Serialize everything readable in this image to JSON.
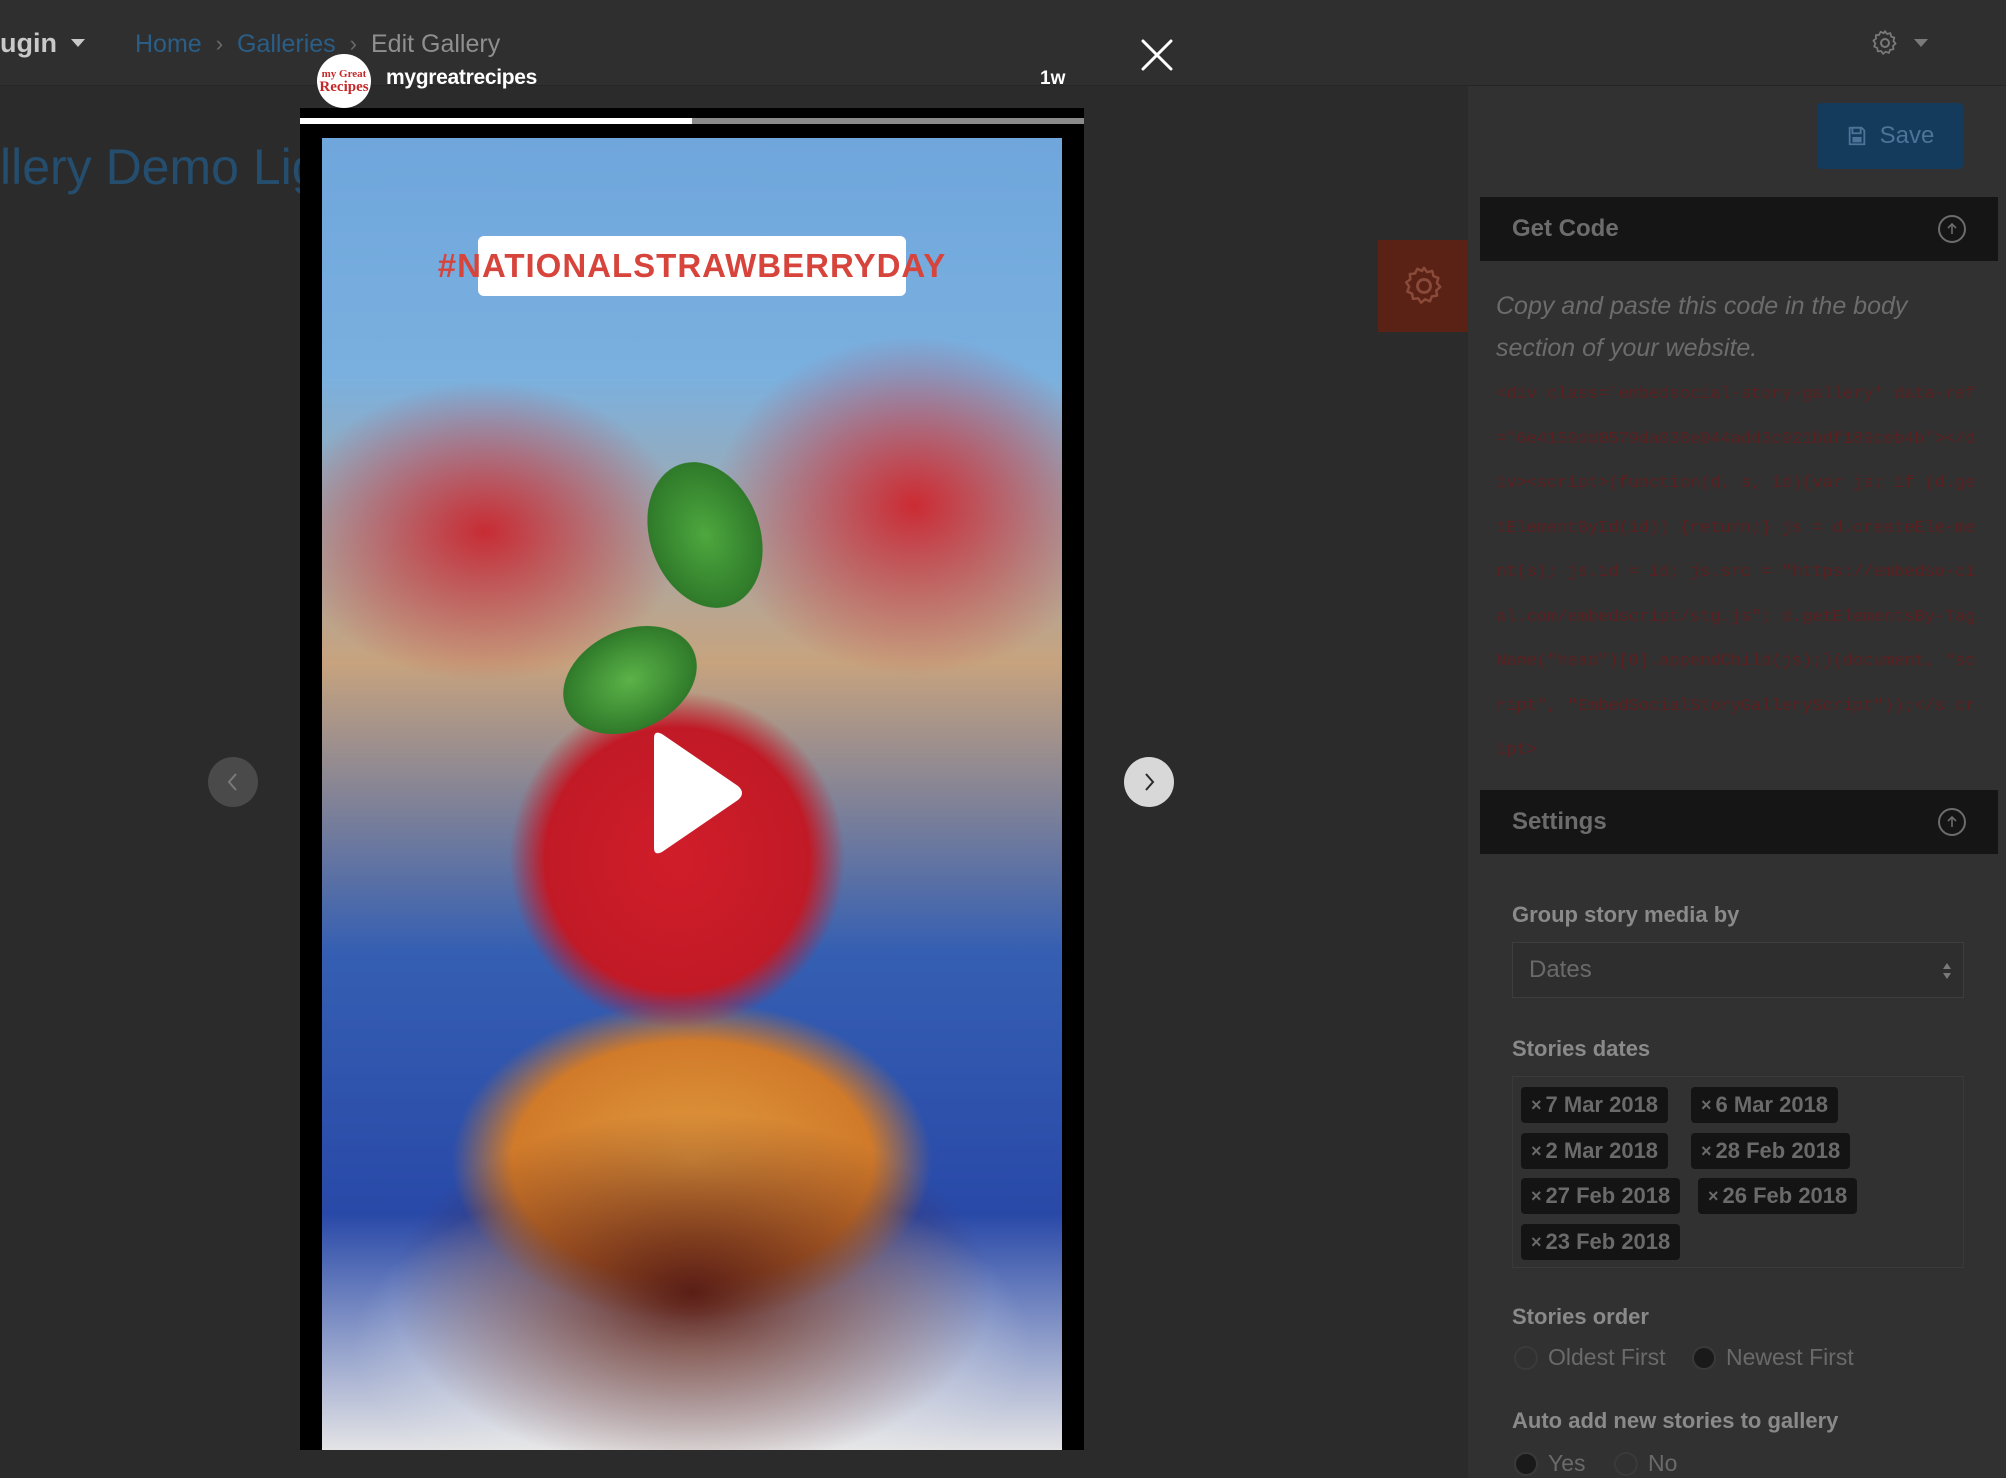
{
  "header": {
    "plugin_menu_label": "ugin",
    "breadcrumb": {
      "home": "Home",
      "sep1": "›",
      "galleries": "Galleries",
      "sep2": "›",
      "current": "Edit Gallery"
    }
  },
  "page": {
    "title": "llery Demo Lig"
  },
  "sidebar": {
    "save_label": "Save",
    "get_code": {
      "title": "Get Code",
      "intro": "Copy and paste this code in the body section of your website.",
      "code": "<div class='embedsocial-story-gallery' data-ref=\"6e4159dd0579da038e044add3c921bdf189ceb4b\"></div><script>(function(d, s, id){var js; if (d.getElementById(id)) {return;} js = d.createEle-ment(s); js.id = id; js.src = \"https://embedso-cial.com/embedscript/stg.js\"; d.getElementsBy-TagName(\"head\")[0].appendChild(js);}(document, \"script\", \"EmbedSocialStoryGalleryScript\"));</s cript>"
    },
    "settings": {
      "title": "Settings",
      "group_by_label": "Group story media by",
      "group_by_value": "Dates",
      "stories_dates_label": "Stories dates",
      "dates": [
        "7 Mar 2018",
        "6 Mar 2018",
        "2 Mar 2018",
        "28 Feb 2018",
        "27 Feb 2018",
        "26 Feb 2018",
        "23 Feb 2018"
      ],
      "order_label": "Stories order",
      "order_options": [
        "Oldest First",
        "Newest First"
      ],
      "auto_add_label": "Auto add new stories to gallery",
      "auto_add_options": [
        "Yes",
        "No"
      ]
    }
  },
  "story": {
    "username": "mygreatrecipes",
    "age": "1w",
    "hashtag": "#NATIONALSTRAWBERRYDAY",
    "avatar_line1": "my Great",
    "avatar_line2": "Recipes",
    "progress": 0.5
  },
  "colors": {
    "hashtag_text": "#d6443c",
    "save_button": "#143a5c",
    "accent_gear_button": "#5a2115"
  },
  "icons": [
    "chevron-down-icon",
    "gear-icon",
    "save-icon",
    "circle-arrow-up-icon",
    "close-icon",
    "play-icon",
    "chevron-left-icon",
    "chevron-right-icon",
    "select-arrows-icon"
  ]
}
